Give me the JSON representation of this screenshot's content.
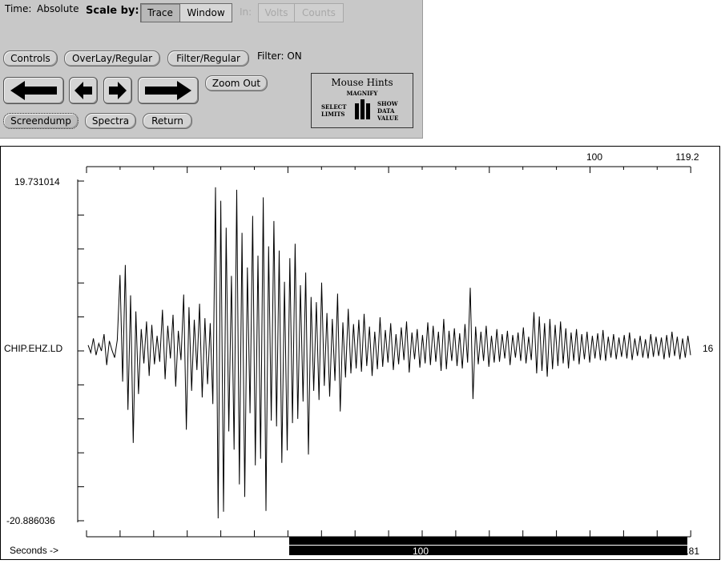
{
  "controls": {
    "time_label": "Time:",
    "time_value": "Absolute",
    "scale_label": "Scale by:",
    "scale_options": [
      "Trace",
      "Window"
    ],
    "in_label": "In:",
    "unit_options": [
      "Volts",
      "Counts"
    ],
    "buttons_row1": [
      "Controls",
      "OverLay/Regular",
      "Filter/Regular"
    ],
    "filter_status": "Filter: ON",
    "zoom_out": "Zoom Out",
    "screendump": "Screendump",
    "spectra": "Spectra",
    "return": "Return"
  },
  "mouse_hints": {
    "title": "Mouse Hints",
    "middle": "MAGNIFY",
    "left": [
      "SELECT",
      "LIMITS"
    ],
    "right": [
      "SHOW",
      "DATA",
      "VALUE"
    ]
  },
  "plot": {
    "top_axis_labels": [
      "100",
      "119.2"
    ],
    "y_max": "19.731014",
    "y_min": "-20.886036",
    "station": "CHIP.EHZ.LD",
    "right_label": "16",
    "bottom_axis_labels": [
      "100",
      "181"
    ],
    "seconds_label": "Seconds ->"
  },
  "chart_data": {
    "type": "line",
    "ylim": [
      -20.886036,
      19.731014
    ],
    "top_x_ticks": [
      100,
      119.2
    ],
    "bottom_x_ticks": [
      100,
      181
    ],
    "series": [
      {
        "values": [
          0.3,
          -0.6,
          1.1,
          -0.9,
          0.5,
          -0.4,
          1.6,
          -2.1,
          0.8,
          -0.3,
          -1.2,
          0.9,
          8.6,
          -4.1,
          9.8,
          -7.5,
          6.2,
          -11.5,
          4.3,
          -5.6,
          2.2,
          -1.9,
          3.1,
          -3.4,
          2.7,
          -2.0,
          1.4,
          -1.7,
          4.5,
          -3.8,
          2.6,
          -1.3,
          3.9,
          -4.7,
          2.0,
          -1.5,
          6.3,
          -9.9,
          4.8,
          -5.2,
          3.3,
          -2.7,
          5.2,
          -6.0,
          3.5,
          -4.4,
          2.9,
          -6.8,
          19.0,
          -20.6,
          17.4,
          -19.8,
          14.2,
          -10.1,
          8.5,
          -12.3,
          18.7,
          -16.5,
          13.6,
          -18.0,
          9.5,
          -7.9,
          15.6,
          -14.2,
          10.9,
          -13.4,
          17.8,
          -19.7,
          12.0,
          -8.8,
          15.0,
          -9.5,
          11.5,
          -13.9,
          7.8,
          -12.4,
          10.6,
          -9.1,
          12.3,
          -8.6,
          7.4,
          -6.5,
          8.9,
          -12.9,
          6.0,
          -5.2,
          5.4,
          -6.3,
          7.7,
          -4.6,
          4.1,
          -5.9,
          3.4,
          -4.0,
          6.4,
          -7.7,
          3.0,
          -3.6,
          4.6,
          -3.1,
          2.8,
          -2.5,
          3.3,
          -2.9,
          4.0,
          -2.2,
          2.5,
          -3.4,
          1.9,
          -2.6,
          3.6,
          -2.3,
          2.1,
          -1.8,
          2.9,
          -2.7,
          1.6,
          -2.0,
          2.4,
          -1.5,
          3.1,
          -3.0,
          1.8,
          -1.4,
          2.2,
          -2.4,
          1.5,
          -1.9,
          3.0,
          -2.1,
          2.6,
          -1.7,
          1.9,
          -2.8,
          3.4,
          -2.6,
          2.0,
          -1.6,
          2.3,
          -2.2,
          1.7,
          -2.5,
          2.8,
          -1.8,
          7.1,
          -6.2,
          2.5,
          -2.0,
          1.9,
          -1.6,
          2.6,
          -2.3,
          1.4,
          -1.8,
          2.2,
          -1.7,
          1.6,
          -1.3,
          2.0,
          -2.1,
          1.5,
          -1.2,
          1.8,
          -1.6,
          2.4,
          -1.9,
          1.3,
          -1.5,
          4.2,
          -3.1,
          3.7,
          -2.8,
          2.9,
          -3.5,
          3.4,
          -2.6,
          2.7,
          -2.2,
          3.1,
          -1.9,
          2.3,
          -2.5,
          1.8,
          -1.6,
          2.2,
          -2.0,
          1.6,
          -1.4,
          1.9,
          -1.8,
          1.4,
          -1.3,
          1.7,
          -1.5,
          2.1,
          -1.6,
          1.3,
          -1.2,
          1.6,
          -1.4,
          1.2,
          -1.1,
          1.5,
          -1.3,
          1.8,
          -1.5,
          1.1,
          -1.0,
          1.4,
          -1.2,
          1.0,
          -1.3,
          1.6,
          -1.1,
          1.3,
          -1.0,
          1.2,
          -1.4,
          1.5,
          -1.2,
          1.9,
          -1.0,
          1.3,
          -1.4,
          1.1,
          -1.2,
          1.4,
          -0.9
        ]
      }
    ]
  }
}
